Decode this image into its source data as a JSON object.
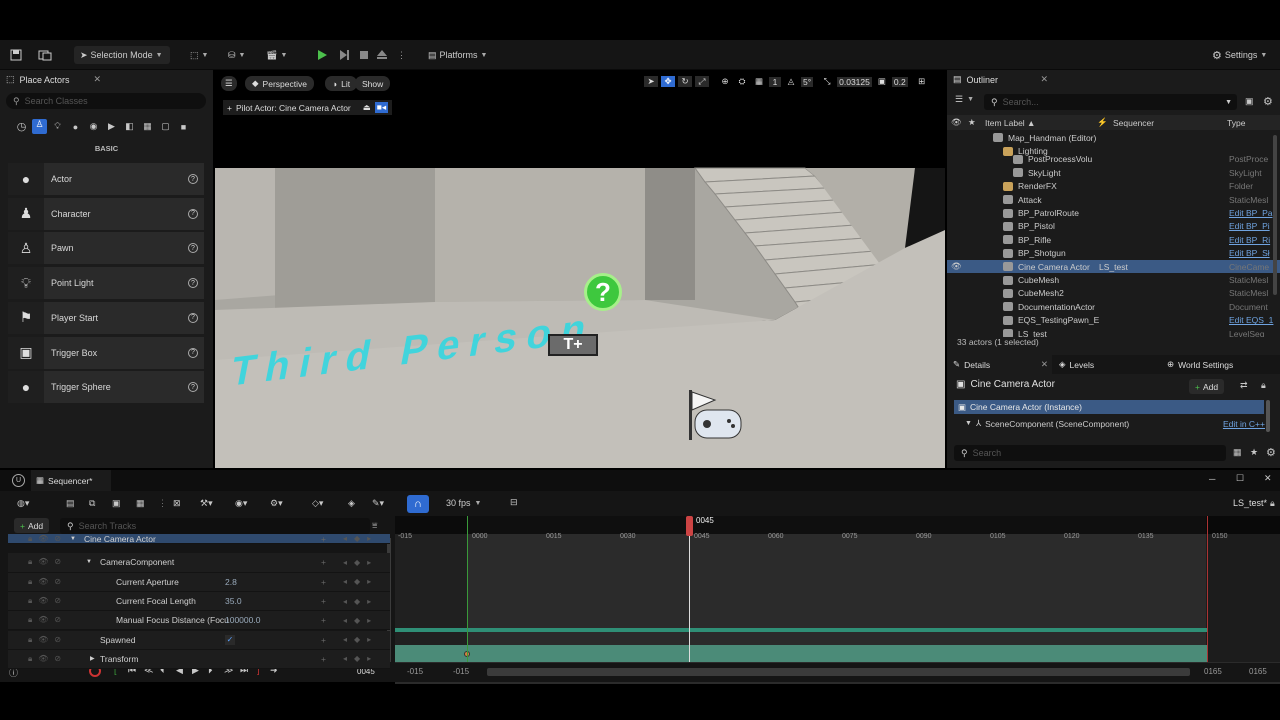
{
  "toolbar": {
    "selection_mode": "Selection Mode",
    "platforms": "Platforms",
    "settings": "Settings"
  },
  "place_actors": {
    "tab": "Place Actors",
    "search_placeholder": "Search Classes",
    "category": "BASIC",
    "items": [
      {
        "label": "Actor",
        "icon": "sphere-icon"
      },
      {
        "label": "Character",
        "icon": "character-icon"
      },
      {
        "label": "Pawn",
        "icon": "pawn-icon"
      },
      {
        "label": "Point Light",
        "icon": "bulb-icon"
      },
      {
        "label": "Player Start",
        "icon": "flag-icon"
      },
      {
        "label": "Trigger Box",
        "icon": "box-icon"
      },
      {
        "label": "Trigger Sphere",
        "icon": "sphere-icon"
      }
    ]
  },
  "viewport": {
    "perspective": "Perspective",
    "lit": "Lit",
    "show": "Show",
    "pilot": "Pilot Actor: Cine Camera Actor",
    "grid": "1",
    "angle": "5°",
    "scale": "0.03125",
    "cam_speed": "0.2",
    "floor_text": "Third Person",
    "text_actor": "T+"
  },
  "outliner": {
    "tab": "Outliner",
    "search_placeholder": "Search...",
    "col_label": "Item Label ▲",
    "col_sequencer": "Sequencer",
    "col_type": "Type",
    "rows": [
      {
        "name": "Map_Handman (Editor)",
        "type": "",
        "indent": 0,
        "folder": false,
        "sel": false,
        "seq": ""
      },
      {
        "name": "Lighting",
        "type": "",
        "indent": 1,
        "folder": true,
        "sel": false,
        "seq": ""
      },
      {
        "name": "PostProcessVolu",
        "type": "PostProce",
        "indent": 2,
        "folder": false,
        "sel": false,
        "seq": ""
      },
      {
        "name": "SkyLight",
        "type": "SkyLight",
        "indent": 2,
        "folder": false,
        "sel": false,
        "seq": ""
      },
      {
        "name": "RenderFX",
        "type": "Folder",
        "indent": 1,
        "folder": true,
        "sel": false,
        "seq": ""
      },
      {
        "name": "Attack",
        "type": "StaticMesl",
        "indent": 1,
        "folder": false,
        "sel": false,
        "seq": ""
      },
      {
        "name": "BP_PatrolRoute",
        "type": "Edit BP_Pa",
        "indent": 1,
        "folder": false,
        "sel": false,
        "seq": "",
        "link": true
      },
      {
        "name": "BP_Pistol",
        "type": "Edit BP_Pi",
        "indent": 1,
        "folder": false,
        "sel": false,
        "seq": "",
        "link": true
      },
      {
        "name": "BP_Rifle",
        "type": "Edit BP_Ri",
        "indent": 1,
        "folder": false,
        "sel": false,
        "seq": "",
        "link": true
      },
      {
        "name": "BP_Shotgun",
        "type": "Edit BP_Sł",
        "indent": 1,
        "folder": false,
        "sel": false,
        "seq": "",
        "link": true
      },
      {
        "name": "Cine Camera Actor",
        "type": "CineCame",
        "indent": 1,
        "folder": false,
        "sel": true,
        "seq": "LS_test"
      },
      {
        "name": "CubeMesh",
        "type": "StaticMesl",
        "indent": 1,
        "folder": false,
        "sel": false,
        "seq": ""
      },
      {
        "name": "CubeMesh2",
        "type": "StaticMesl",
        "indent": 1,
        "folder": false,
        "sel": false,
        "seq": ""
      },
      {
        "name": "DocumentationActor",
        "type": "Document",
        "indent": 1,
        "folder": false,
        "sel": false,
        "seq": ""
      },
      {
        "name": "EQS_TestingPawn_E",
        "type": "Edit EQS_1",
        "indent": 1,
        "folder": false,
        "sel": false,
        "seq": "",
        "link": true
      },
      {
        "name": "LS_test",
        "type": "LevelSeq",
        "indent": 1,
        "folder": false,
        "sel": false,
        "seq": ""
      }
    ],
    "count": "33 actors (1 selected)"
  },
  "details": {
    "tab_details": "Details",
    "tab_levels": "Levels",
    "tab_world": "World Settings",
    "title": "Cine Camera Actor",
    "add": "Add",
    "instance": "Cine Camera Actor (Instance)",
    "scene": "SceneComponent (SceneComponent)",
    "edit_cpp": "Edit in C++",
    "search_placeholder": "Search"
  },
  "sequencer": {
    "tab": "Sequencer*",
    "fps": "30 fps",
    "sequence_name": "LS_test*",
    "add": "Add",
    "search_placeholder": "Search Tracks",
    "playhead": "0045",
    "tracks": [
      {
        "label": "Cine Camera Actor",
        "value": "",
        "indent": 1,
        "kind": "actor"
      },
      {
        "label": "CameraComponent",
        "value": "",
        "indent": 2,
        "kind": "comp"
      },
      {
        "label": "Current Aperture",
        "value": "2.8",
        "indent": 3,
        "kind": "prop"
      },
      {
        "label": "Current Focal Length",
        "value": "35.0",
        "indent": 3,
        "kind": "prop"
      },
      {
        "label": "Manual Focus Distance (Focu",
        "value": "100000.0",
        "indent": 3,
        "kind": "prop"
      },
      {
        "label": "Spawned",
        "value": "✓",
        "indent": 2,
        "kind": "check"
      },
      {
        "label": "Transform",
        "value": "",
        "indent": 2,
        "kind": "prop"
      }
    ],
    "ticks": [
      "-015",
      "0000",
      "0015",
      "0030",
      "0045",
      "0060",
      "0075",
      "0090",
      "0105",
      "0120",
      "0135",
      "0150"
    ],
    "bottom": {
      "frame": "0045",
      "start": "-015",
      "start2": "-015",
      "end": "0165",
      "end2": "0165"
    }
  }
}
